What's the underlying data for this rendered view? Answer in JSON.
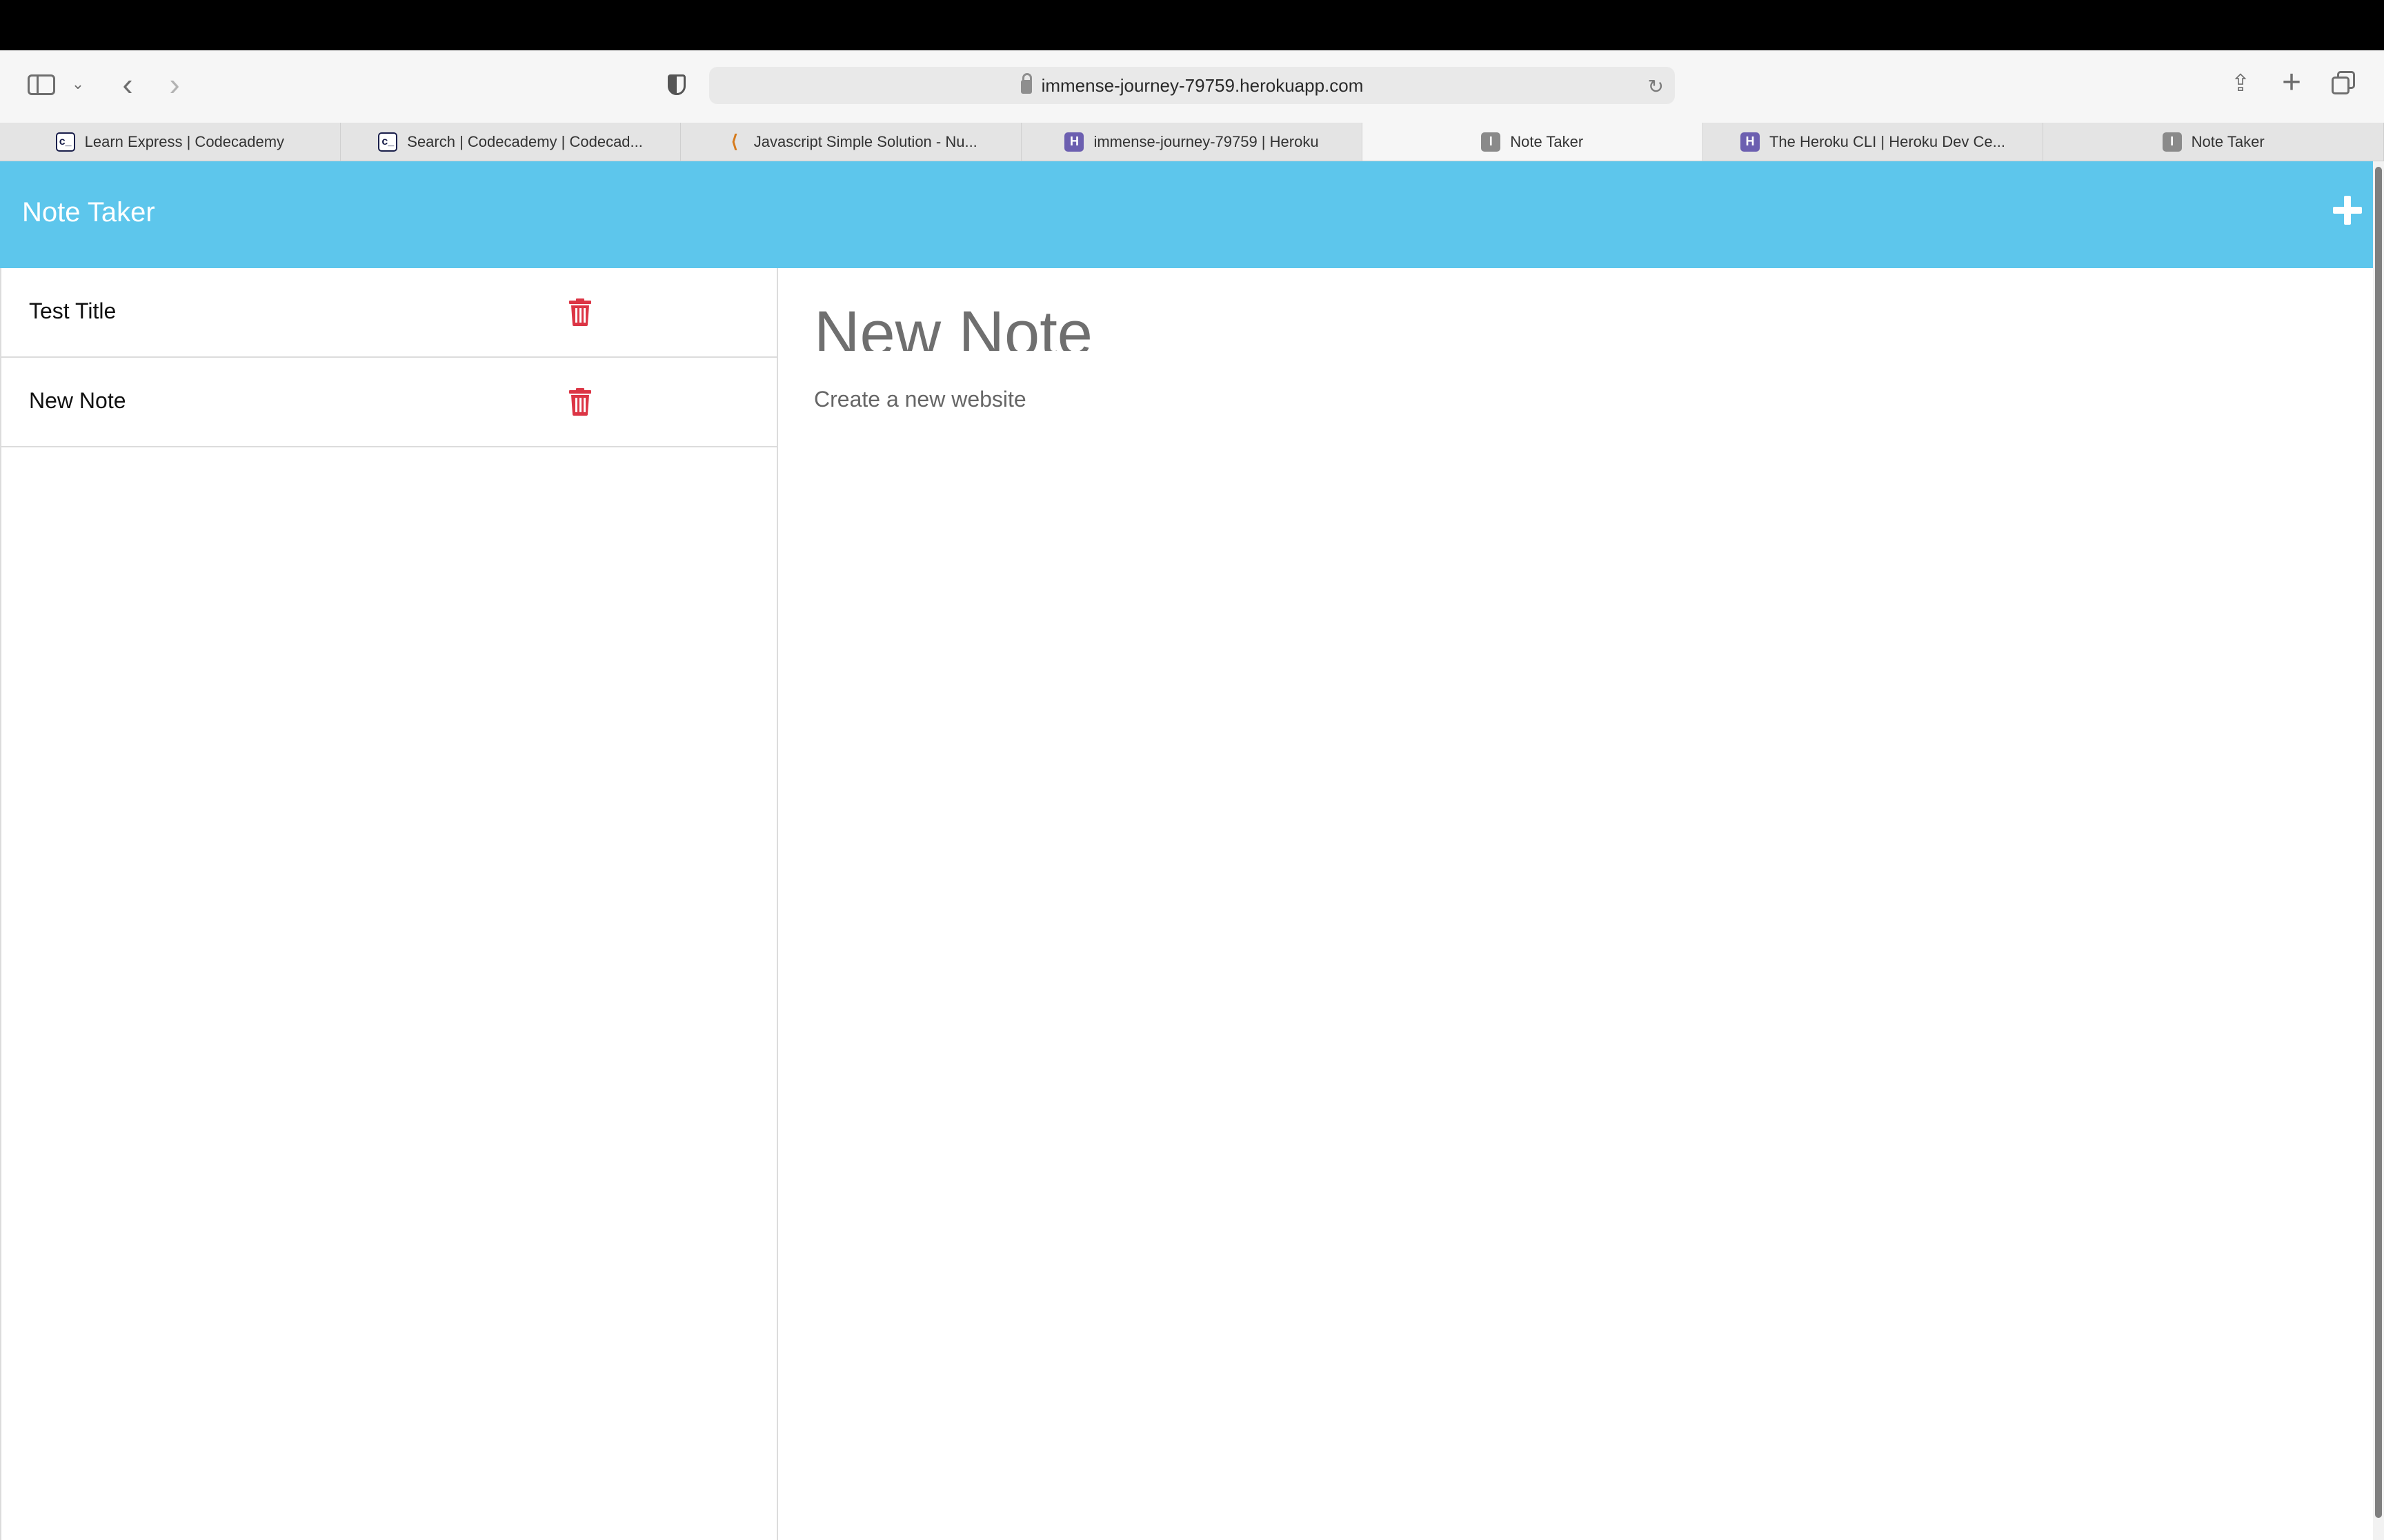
{
  "browser": {
    "url": "immense-journey-79759.herokuapp.com",
    "tabs": [
      {
        "label": "Learn Express | Codecademy",
        "favicon": "codecademy-icon",
        "active": false
      },
      {
        "label": "Search | Codecademy | Codecad...",
        "favicon": "codecademy-icon",
        "active": false
      },
      {
        "label": "Javascript Simple Solution - Nu...",
        "favicon": "freecodecamp-icon",
        "active": false
      },
      {
        "label": "immense-journey-79759 | Heroku",
        "favicon": "heroku-icon",
        "active": false
      },
      {
        "label": "Note Taker",
        "favicon": "note-taker-icon",
        "active": true
      },
      {
        "label": "The Heroku CLI | Heroku Dev Ce...",
        "favicon": "heroku-icon",
        "active": false
      },
      {
        "label": "Note Taker",
        "favicon": "note-taker-icon",
        "active": false
      }
    ],
    "favicon_text": {
      "codecademy": "c_",
      "heroku": "H",
      "note": "I",
      "fcc": "⟨"
    }
  },
  "app": {
    "title": "Note Taker",
    "header_color": "#5dc6ec",
    "notes": [
      {
        "title": "Test Title"
      },
      {
        "title": "New Note"
      }
    ],
    "active_note": {
      "title": "New Note",
      "text": "Create a new website"
    },
    "delete_color": "#dc3545"
  }
}
